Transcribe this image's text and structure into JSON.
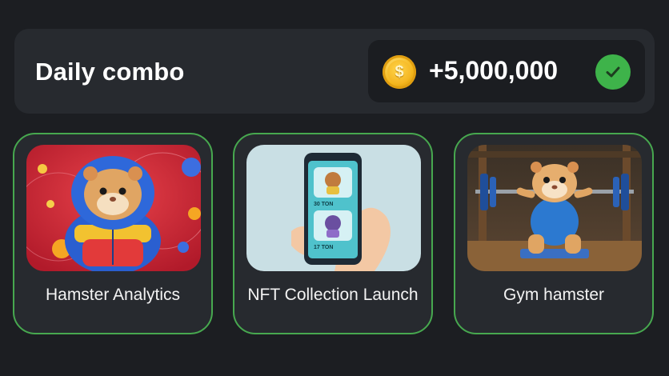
{
  "header": {
    "title": "Daily combo",
    "reward_amount": "+5,000,000",
    "coin_icon": "coin-icon",
    "coin_symbol": "$",
    "check_icon": "check-icon"
  },
  "cards": [
    {
      "label": "Hamster Analytics",
      "image": "hamster-puffer-jacket-illustration"
    },
    {
      "label": "NFT Collection Launch",
      "image": "phone-nft-illustration",
      "phone_rows": [
        "30 TON",
        "17 TON"
      ]
    },
    {
      "label": "Gym hamster",
      "image": "hamster-weightlifting-illustration"
    }
  ],
  "colors": {
    "background": "#1c1e22",
    "panel": "#272a2f",
    "card_border": "#47a84f",
    "check_green": "#3eb34a",
    "coin_gold": "#f5b81c"
  }
}
